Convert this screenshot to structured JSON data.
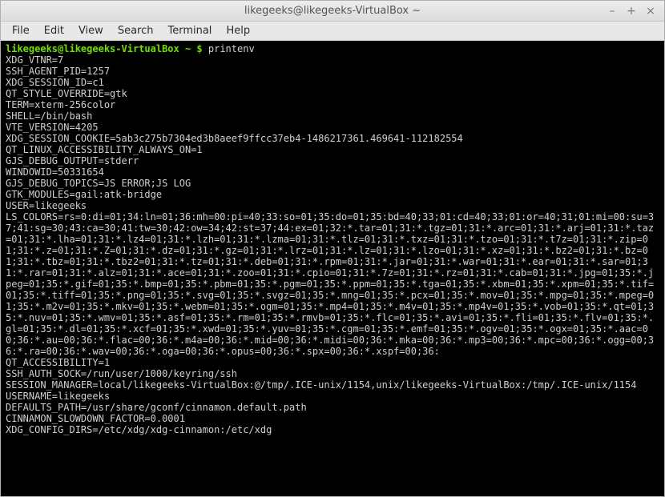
{
  "window": {
    "title": "likegeeks@likegeeks-VirtualBox ~",
    "controls": {
      "minimize": "–",
      "maximize": "+",
      "close": "×"
    }
  },
  "menubar": {
    "items": [
      "File",
      "Edit",
      "View",
      "Search",
      "Terminal",
      "Help"
    ]
  },
  "terminal": {
    "prompt": {
      "user_host": "likegeeks@likegeeks-VirtualBox",
      "path": "~",
      "symbol": "$"
    },
    "command": "printenv",
    "output_lines": [
      "XDG_VTNR=7",
      "SSH_AGENT_PID=1257",
      "XDG_SESSION_ID=c1",
      "QT_STYLE_OVERRIDE=gtk",
      "TERM=xterm-256color",
      "SHELL=/bin/bash",
      "VTE_VERSION=4205",
      "XDG_SESSION_COOKIE=5ab3c275b7304ed3b8aeef9ffcc37eb4-1486217361.469641-112182554",
      "QT_LINUX_ACCESSIBILITY_ALWAYS_ON=1",
      "GJS_DEBUG_OUTPUT=stderr",
      "WINDOWID=50331654",
      "GJS_DEBUG_TOPICS=JS ERROR;JS LOG",
      "GTK_MODULES=gail:atk-bridge",
      "USER=likegeeks",
      "LS_COLORS=rs=0:di=01;34:ln=01;36:mh=00:pi=40;33:so=01;35:do=01;35:bd=40;33;01:cd=40;33;01:or=40;31;01:mi=00:su=37;41:sg=30;43:ca=30;41:tw=30;42:ow=34;42:st=37;44:ex=01;32:*.tar=01;31:*.tgz=01;31:*.arc=01;31:*.arj=01;31:*.taz=01;31:*.lha=01;31:*.lz4=01;31:*.lzh=01;31:*.lzma=01;31:*.tlz=01;31:*.txz=01;31:*.tzo=01;31:*.t7z=01;31:*.zip=01;31:*.z=01;31:*.Z=01;31:*.dz=01;31:*.gz=01;31:*.lrz=01;31:*.lz=01;31:*.lzo=01;31:*.xz=01;31:*.bz2=01;31:*.bz=01;31:*.tbz=01;31:*.tbz2=01;31:*.tz=01;31:*.deb=01;31:*.rpm=01;31:*.jar=01;31:*.war=01;31:*.ear=01;31:*.sar=01;31:*.rar=01;31:*.alz=01;31:*.ace=01;31:*.zoo=01;31:*.cpio=01;31:*.7z=01;31:*.rz=01;31:*.cab=01;31:*.jpg=01;35:*.jpeg=01;35:*.gif=01;35:*.bmp=01;35:*.pbm=01;35:*.pgm=01;35:*.ppm=01;35:*.tga=01;35:*.xbm=01;35:*.xpm=01;35:*.tif=01;35:*.tiff=01;35:*.png=01;35:*.svg=01;35:*.svgz=01;35:*.mng=01;35:*.pcx=01;35:*.mov=01;35:*.mpg=01;35:*.mpeg=01;35:*.m2v=01;35:*.mkv=01;35:*.webm=01;35:*.ogm=01;35:*.mp4=01;35:*.m4v=01;35:*.mp4v=01;35:*.vob=01;35:*.qt=01;35:*.nuv=01;35:*.wmv=01;35:*.asf=01;35:*.rm=01;35:*.rmvb=01;35:*.flc=01;35:*.avi=01;35:*.fli=01;35:*.flv=01;35:*.gl=01;35:*.dl=01;35:*.xcf=01;35:*.xwd=01;35:*.yuv=01;35:*.cgm=01;35:*.emf=01;35:*.ogv=01;35:*.ogx=01;35:*.aac=00;36:*.au=00;36:*.flac=00;36:*.m4a=00;36:*.mid=00;36:*.midi=00;36:*.mka=00;36:*.mp3=00;36:*.mpc=00;36:*.ogg=00;36:*.ra=00;36:*.wav=00;36:*.oga=00;36:*.opus=00;36:*.spx=00;36:*.xspf=00;36:",
      "QT_ACCESSIBILITY=1",
      "SSH_AUTH_SOCK=/run/user/1000/keyring/ssh",
      "SESSION_MANAGER=local/likegeeks-VirtualBox:@/tmp/.ICE-unix/1154,unix/likegeeks-VirtualBox:/tmp/.ICE-unix/1154",
      "USERNAME=likegeeks",
      "DEFAULTS_PATH=/usr/share/gconf/cinnamon.default.path",
      "CINNAMON_SLOWDOWN_FACTOR=0.0001",
      "XDG_CONFIG_DIRS=/etc/xdg/xdg-cinnamon:/etc/xdg"
    ]
  }
}
